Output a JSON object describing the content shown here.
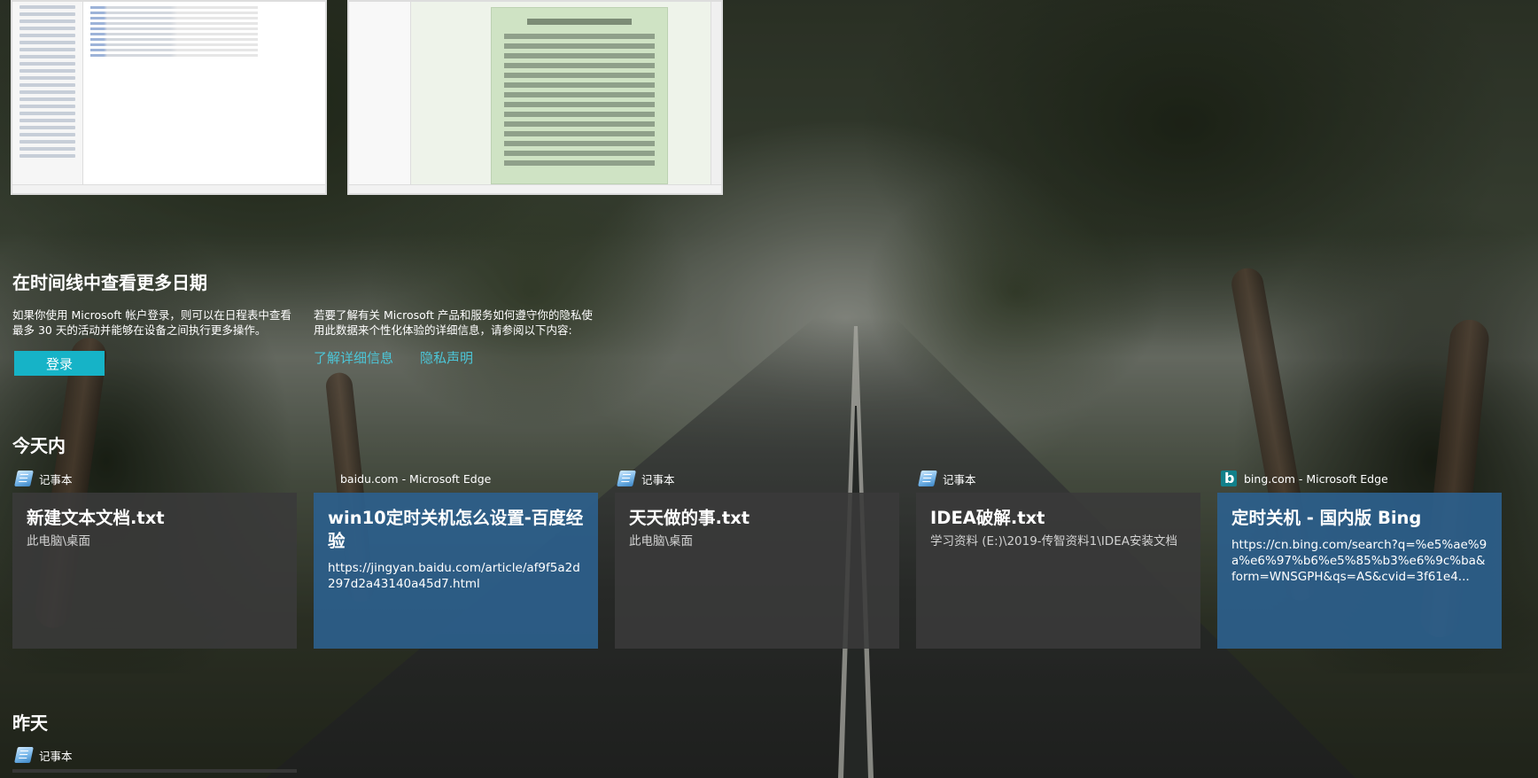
{
  "signin": {
    "title": "在时间线中查看更多日期",
    "description": "如果你使用 Microsoft 帐户登录，则可以在日程表中查看最多 30 天的活动并能够在设备之间执行更多操作。",
    "button": "登录",
    "privacy_text": "若要了解有关 Microsoft 产品和服务如何遵守你的隐私使用此数据来个性化体验的详细信息，请参阅以下内容:",
    "learn_more": "了解详细信息",
    "privacy_statement": "隐私声明"
  },
  "today": {
    "heading": "今天内",
    "activities": [
      {
        "app": "记事本",
        "icon": "notepad-icon",
        "title": "新建文本文档.txt",
        "subtitle": "此电脑\\桌面"
      },
      {
        "app": "baidu.com - Microsoft Edge",
        "icon": "edge-icon",
        "title": "win10定时关机怎么设置-百度经验",
        "url": "https://jingyan.baidu.com/article/af9f5a2d297d2a43140a45d7.html"
      },
      {
        "app": "记事本",
        "icon": "notepad-icon",
        "title": "天天做的事.txt",
        "subtitle": "此电脑\\桌面"
      },
      {
        "app": "记事本",
        "icon": "notepad-icon",
        "title": "IDEA破解.txt",
        "subtitle": "学习资料 (E:)\\2019-传智资料1\\IDEA安装文档"
      },
      {
        "app": "bing.com - Microsoft Edge",
        "icon": "bing-icon",
        "title": "定时关机 - 国内版 Bing",
        "url": "https://cn.bing.com/search?q=%e5%ae%9a%e6%97%b6%e5%85%b3%e6%9c%ba&form=WNSGPH&qs=AS&cvid=3f61e4..."
      }
    ]
  },
  "yesterday": {
    "heading": "昨天",
    "activities": [
      {
        "app": "记事本",
        "icon": "notepad-icon"
      }
    ]
  }
}
